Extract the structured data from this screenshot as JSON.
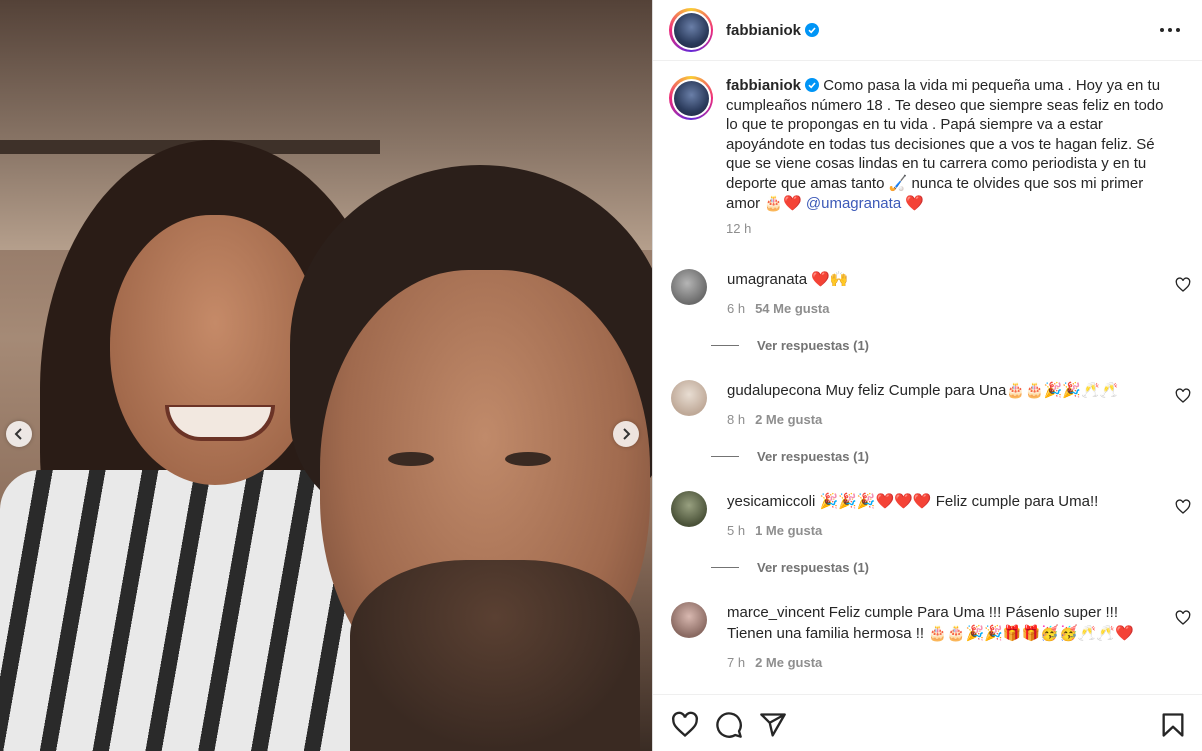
{
  "post": {
    "username": "fabbianiok",
    "caption_user": "fabbianiok",
    "caption": "Como pasa la vida mi pequeña uma . Hoy ya en tu cumpleaños número 18 . Te deseo que siempre seas feliz en todo lo que te propongas en tu vida . Papá siempre va a estar apoyándote en todas tus decisiones que a vos te hagan feliz. Sé que se viene cosas lindas en tu carrera como periodista y en tu deporte que amas tanto 🏑 nunca te olvides que sos mi primer amor 🎂❤️",
    "caption_mention": "@umagranata",
    "caption_end": "❤️",
    "time": "12 h"
  },
  "comments": [
    {
      "user": "umagranata",
      "text": "❤️🙌",
      "time": "6 h",
      "likes": "54 Me gusta",
      "replies": "Ver respuestas (1)",
      "avatar_color": "#8a8a8a"
    },
    {
      "user": "gudalupecona",
      "text": "Muy feliz Cumple para Una🎂🎂🎉🎉🥂🥂",
      "time": "8 h",
      "likes": "2 Me gusta",
      "replies": "Ver respuestas (1)",
      "avatar_color": "#c9b8a8"
    },
    {
      "user": "yesicamiccoli",
      "text": "🎉🎉🎉❤️❤️❤️ Feliz cumple para Uma!!",
      "time": "5 h",
      "likes": "1 Me gusta",
      "replies": "Ver respuestas (1)",
      "avatar_color": "#6e7a5a"
    },
    {
      "user": "marce_vincent",
      "text": "Feliz cumple Para Uma !!! Pásenlo super !!! Tienen una familia hermosa !! 🎂🎂🎉🎉🎁🎁🥳🥳🥂🥂❤️",
      "time": "7 h",
      "likes": "2 Me gusta",
      "avatar_color": "#b0908a"
    }
  ],
  "colors": {
    "verified": "#0095f6",
    "mention": "#3d5ab8",
    "meta": "#8e8e8e"
  },
  "icons": [
    "chevron-left-icon",
    "chevron-right-icon",
    "more-icon",
    "verified-icon",
    "heart-icon",
    "comment-icon",
    "share-icon",
    "bookmark-icon"
  ]
}
